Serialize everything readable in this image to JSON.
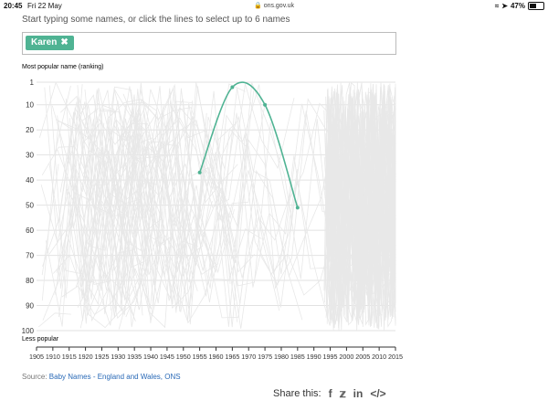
{
  "status_bar": {
    "time": "20:45",
    "date": "Fri 22 May",
    "url": "ons.gov.uk",
    "battery": "47%",
    "battery_level": 0.47
  },
  "instructions": "Start typing some names, or click the lines to select up to 6 names",
  "selected_names": [
    {
      "label": "Karen",
      "color": "#4fb393"
    }
  ],
  "chart_data": {
    "type": "line",
    "title": "",
    "ylabel_top": "Most popular name (ranking)",
    "ylabel_bottom": "Less popular",
    "y_reversed": true,
    "ylim": [
      1,
      100
    ],
    "xlim": [
      1905,
      2015
    ],
    "y_ticks": [
      1,
      10,
      20,
      30,
      40,
      50,
      60,
      70,
      80,
      90,
      100
    ],
    "x_ticks": [
      1905,
      1910,
      1915,
      1920,
      1925,
      1930,
      1935,
      1940,
      1945,
      1950,
      1955,
      1960,
      1965,
      1970,
      1975,
      1980,
      1985,
      1990,
      1995,
      2000,
      2005,
      2010,
      2015
    ],
    "grid": true,
    "background_lines_color": "#e8e8e8",
    "series": [
      {
        "name": "Karen",
        "color": "#4fb393",
        "points": [
          {
            "x": 1955,
            "y": 37
          },
          {
            "x": 1965,
            "y": 3
          },
          {
            "x": 1975,
            "y": 10
          },
          {
            "x": 1985,
            "y": 51
          }
        ]
      }
    ]
  },
  "source": {
    "prefix": "Source: ",
    "link_text": "Baby Names - England and Wales, ONS"
  },
  "share": {
    "label": "Share this:",
    "icons": [
      "facebook-icon",
      "twitter-icon",
      "linkedin-icon",
      "embed-icon"
    ]
  }
}
